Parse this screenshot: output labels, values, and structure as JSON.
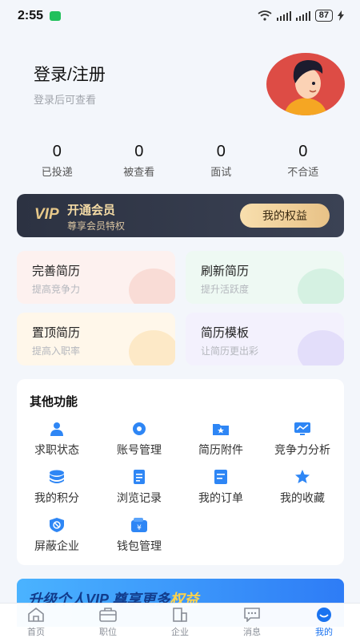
{
  "status_bar": {
    "time": "2:55",
    "battery": "87"
  },
  "profile": {
    "title": "登录/注册",
    "subtitle": "登录后可查看"
  },
  "stats": [
    {
      "value": "0",
      "label": "已投递"
    },
    {
      "value": "0",
      "label": "被查看"
    },
    {
      "value": "0",
      "label": "面试"
    },
    {
      "value": "0",
      "label": "不合适"
    }
  ],
  "vip": {
    "logo": "VIP",
    "title": "开通会员",
    "subtitle": "尊享会员特权",
    "button": "我的权益"
  },
  "cards": [
    {
      "title": "完善简历",
      "subtitle": "提高竞争力"
    },
    {
      "title": "刷新简历",
      "subtitle": "提升活跃度"
    },
    {
      "title": "置顶简历",
      "subtitle": "提高入职率"
    },
    {
      "title": "简历模板",
      "subtitle": "让简历更出彩"
    }
  ],
  "functions": {
    "heading": "其他功能",
    "items": [
      {
        "label": "求职状态",
        "icon": "person-icon"
      },
      {
        "label": "账号管理",
        "icon": "gear-icon"
      },
      {
        "label": "简历附件",
        "icon": "folder-star-icon"
      },
      {
        "label": "竞争力分析",
        "icon": "chart-icon"
      },
      {
        "label": "我的积分",
        "icon": "coins-icon"
      },
      {
        "label": "浏览记录",
        "icon": "document-icon"
      },
      {
        "label": "我的订单",
        "icon": "order-icon"
      },
      {
        "label": "我的收藏",
        "icon": "star-icon"
      },
      {
        "label": "屏蔽企业",
        "icon": "block-icon"
      },
      {
        "label": "钱包管理",
        "icon": "wallet-icon"
      }
    ]
  },
  "banner": {
    "text": "升级个人VIP  尊享更多",
    "highlight": "权益"
  },
  "tabs": [
    {
      "label": "首页",
      "icon": "home-icon"
    },
    {
      "label": "职位",
      "icon": "briefcase-icon"
    },
    {
      "label": "企业",
      "icon": "building-icon"
    },
    {
      "label": "消息",
      "icon": "message-icon"
    },
    {
      "label": "我的",
      "icon": "profile-icon",
      "active": true
    }
  ],
  "colors": {
    "accent": "#1a73f0",
    "icon_blue": "#2e86f5",
    "vip_gold": "#f5dca6"
  }
}
